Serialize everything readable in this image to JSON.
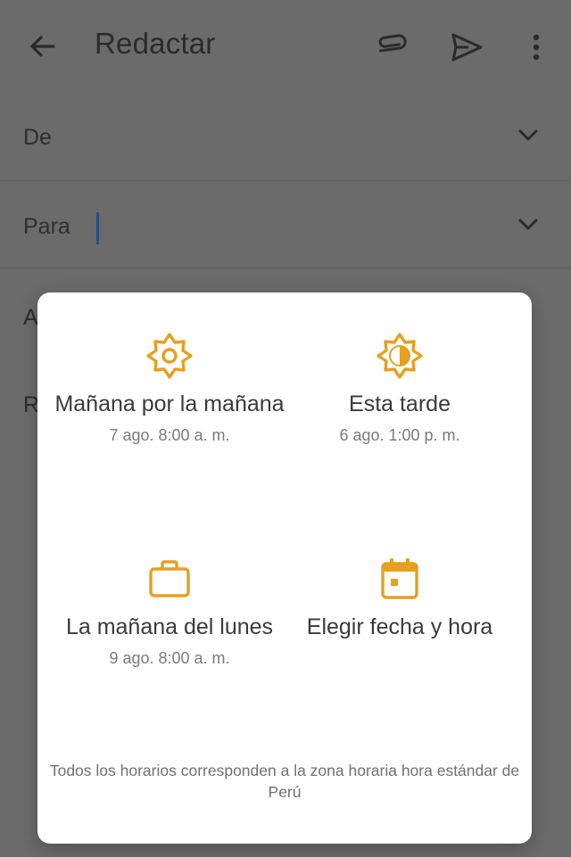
{
  "app_bar": {
    "title": "Redactar",
    "icons": [
      "arrow-back-icon",
      "attach-icon",
      "send-icon",
      "more-vert-icon"
    ]
  },
  "fields": {
    "from_label": "De",
    "to_label": "Para",
    "subject_partial": "A",
    "body_partial": "R"
  },
  "schedule_dialog": {
    "options": [
      {
        "icon": "sun-icon",
        "label": "Mañana por la mañana",
        "detail": "7 ago. 8:00 a. m."
      },
      {
        "icon": "half-sun-icon",
        "label": "Esta tarde",
        "detail": "6 ago. 1:00 p. m."
      },
      {
        "icon": "briefcase-icon",
        "label": "La mañana del lunes",
        "detail": "9 ago. 8:00 a. m."
      },
      {
        "icon": "calendar-icon",
        "label": "Elegir fecha y hora",
        "detail": ""
      }
    ],
    "footnote": "Todos los horarios corresponden a la zona horaria hora estándar de Perú"
  },
  "colors": {
    "scrim": "#6b6b6b",
    "dialog_bg": "#ffffff",
    "icon_accent": "#e5a020",
    "cursor": "#2c4a86"
  }
}
